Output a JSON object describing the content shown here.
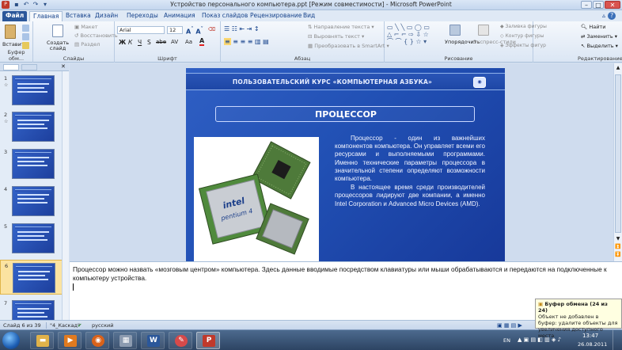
{
  "window": {
    "title": "Устройство персонального компьютера.ppt [Режим совместимости] - Microsoft PowerPoint",
    "min_label": "–",
    "max_label": "□",
    "close_label": "✕"
  },
  "tabs": [
    "Файл",
    "Главная",
    "Вставка",
    "Дизайн",
    "Переходы",
    "Анимация",
    "Показ слайдов",
    "Рецензирование",
    "Вид"
  ],
  "ribbon": {
    "clipboard": {
      "paste": "Вставить",
      "label": "Буфер обм..."
    },
    "slides": {
      "new_slide": "Создать слайд",
      "layout": "Макет",
      "reset": "Восстановить",
      "section": "Раздел",
      "label": "Слайды"
    },
    "font": {
      "family": "Arial",
      "size": "12",
      "label": "Шрифт",
      "bold": "Ж",
      "italic": "К",
      "underline": "Ч",
      "strike": "S",
      "shadow": "abe",
      "spacing": "AV",
      "case": "Aa",
      "color": "A"
    },
    "paragraph": {
      "direction": "Направление текста",
      "align": "Выровнять текст",
      "smartart": "Преобразовать в SmartArt",
      "label": "Абзац"
    },
    "drawing": {
      "arrange": "Упорядочить",
      "quick_styles": "Экспресс-стили",
      "fill": "Заливка фигуры",
      "outline": "Контур фигуры",
      "effects": "Эффекты фигур",
      "label": "Рисование"
    },
    "editing": {
      "find": "Найти",
      "replace": "Заменить",
      "select": "Выделить",
      "label": "Редактирование"
    }
  },
  "thumbnails": [
    {
      "num": "1",
      "star": "☆",
      "selected": false
    },
    {
      "num": "2",
      "star": "☆",
      "selected": false
    },
    {
      "num": "3",
      "star": "",
      "selected": false
    },
    {
      "num": "4",
      "star": "",
      "selected": false
    },
    {
      "num": "5",
      "star": "",
      "selected": false
    },
    {
      "num": "6",
      "star": "",
      "selected": true
    },
    {
      "num": "7",
      "star": "",
      "selected": false
    }
  ],
  "slide": {
    "header": "ПОЛЬЗОВАТЕЛЬСКИЙ КУРС «КОМПЬЮТЕРНАЯ АЗБУКА»",
    "title": "ПРОЦЕССОР",
    "body_p1": "Процессор - один из важнейших компонентов компьютера. Он управляет всеми его ресурсами и выполняемыми программами. Именно технические параметры процессора в значительной степени определяют возможности компьютера.",
    "body_p2": "В настоящее время среди производителей процессоров лидируют две компании, а именно Intel Corporation и Advanced Micro Devices (AMD).",
    "chip_brand": "intel",
    "chip_model": "pentium 4"
  },
  "notes": "Процессор можно назвать «мозговым центром» компьютера. Здесь данные вводимые посредством клавиатуры или мыши обрабатываются и передаются на подключенные к компьютеру устройства.",
  "clipboard_tip": {
    "title": "Буфер обмена (24 из 24)",
    "text": "Объект не добавлен в буфер: удалите объекты для увеличения доступного места"
  },
  "status": {
    "slide": "Слайд 6 из 39",
    "theme": "\"4_Каскад\"",
    "lang": "русский"
  },
  "taskbar": {
    "lang": "EN",
    "time": "13:47",
    "date": "26.08.2011"
  }
}
